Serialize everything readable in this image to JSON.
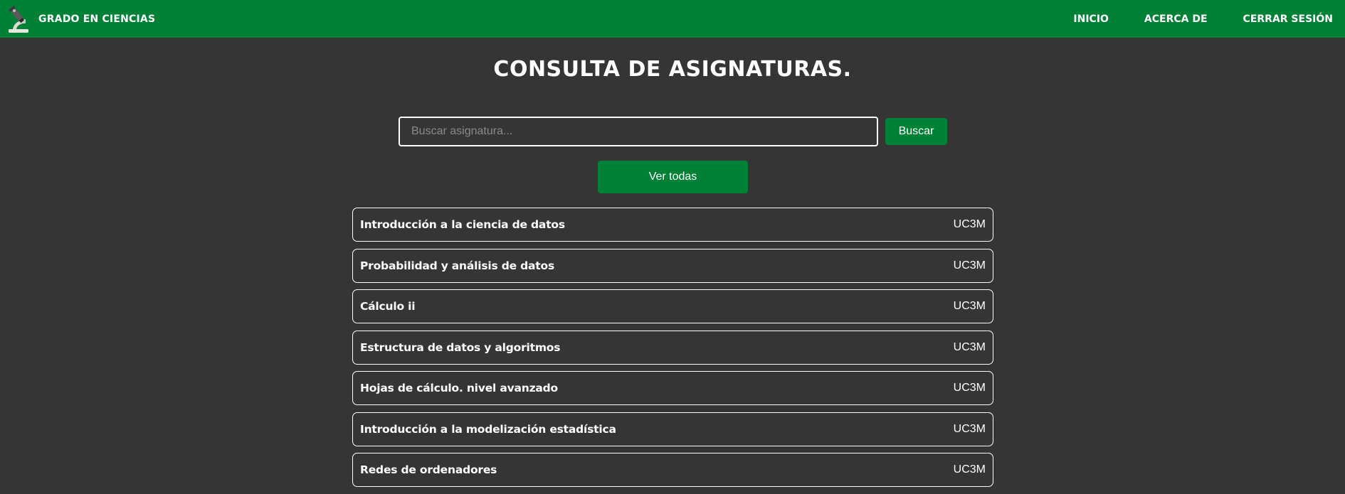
{
  "nav": {
    "brand_icon": "microscope-icon",
    "brand_text": "Grado en Ciencias",
    "links": [
      {
        "label": "Inicio"
      },
      {
        "label": "Acerca de"
      },
      {
        "label": "Cerrar sesión"
      }
    ]
  },
  "main": {
    "title": "Consulta de asignaturas.",
    "search": {
      "placeholder": "Buscar asignatura...",
      "value": "",
      "button_label": "Buscar"
    },
    "view_all_label": "Ver todas",
    "courses": [
      {
        "name": "Introducción a la ciencia de datos",
        "university": "UC3M"
      },
      {
        "name": "Probabilidad y análisis de datos",
        "university": "UC3M"
      },
      {
        "name": "Cálculo ii",
        "university": "UC3M"
      },
      {
        "name": "Estructura de datos y algoritmos",
        "university": "UC3M"
      },
      {
        "name": "Hojas de cálculo. nivel avanzado",
        "university": "UC3M"
      },
      {
        "name": "Introducción a la modelización estadística",
        "university": "UC3M"
      },
      {
        "name": "Redes de ordenadores",
        "university": "UC3M"
      }
    ]
  },
  "colors": {
    "accent": "#008136",
    "background": "#353535",
    "text": "#ffffff"
  }
}
